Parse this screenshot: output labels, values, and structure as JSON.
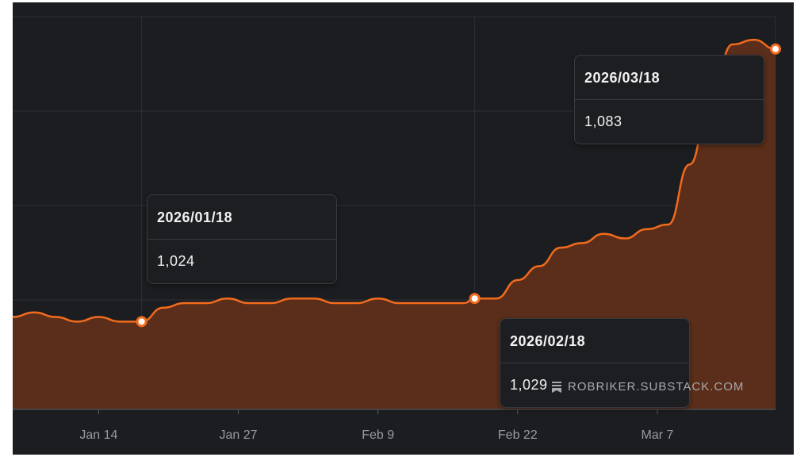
{
  "chart_data": {
    "type": "area",
    "x": [
      "2026-01-06",
      "2026-01-08",
      "2026-01-10",
      "2026-01-12",
      "2026-01-14",
      "2026-01-16",
      "2026-01-18",
      "2026-01-20",
      "2026-01-22",
      "2026-01-24",
      "2026-01-26",
      "2026-01-28",
      "2026-01-30",
      "2026-02-01",
      "2026-02-03",
      "2026-02-05",
      "2026-02-07",
      "2026-02-09",
      "2026-02-11",
      "2026-02-13",
      "2026-02-15",
      "2026-02-17",
      "2026-02-18",
      "2026-02-20",
      "2026-02-22",
      "2026-02-24",
      "2026-02-26",
      "2026-02-28",
      "2026-03-02",
      "2026-03-04",
      "2026-03-06",
      "2026-03-08",
      "2026-03-10",
      "2026-03-12",
      "2026-03-14",
      "2026-03-16",
      "2026-03-18"
    ],
    "series": [
      {
        "values": [
          1025,
          1026,
          1025,
          1024,
          1025,
          1024,
          1024,
          1027,
          1028,
          1028,
          1029,
          1028,
          1028,
          1029,
          1029,
          1028,
          1028,
          1029,
          1028,
          1028,
          1028,
          1028,
          1029,
          1029,
          1033,
          1036,
          1040,
          1041,
          1043,
          1042,
          1044,
          1045,
          1058,
          1073,
          1084,
          1085,
          1083
        ]
      }
    ],
    "xticks": [
      "Jan 14",
      "Jan 27",
      "Feb 9",
      "Feb 22",
      "Mar 7"
    ],
    "xlabel": "",
    "ylabel": "",
    "ylim": [
      1005,
      1090
    ],
    "grid": true,
    "colors": {
      "line": "#f26b1d",
      "fill": "#5a2e1a",
      "background": "#1c1d20",
      "grid": "#2e2f33"
    },
    "annotations": [
      {
        "date": "2026/01/18",
        "value": "1,024"
      },
      {
        "date": "2026/02/18",
        "value": "1,029"
      },
      {
        "date": "2026/03/18",
        "value": "1,083"
      }
    ]
  },
  "watermark": {
    "text": "ROBRIKER.SUBSTACK.COM",
    "icon": "substack-icon"
  }
}
